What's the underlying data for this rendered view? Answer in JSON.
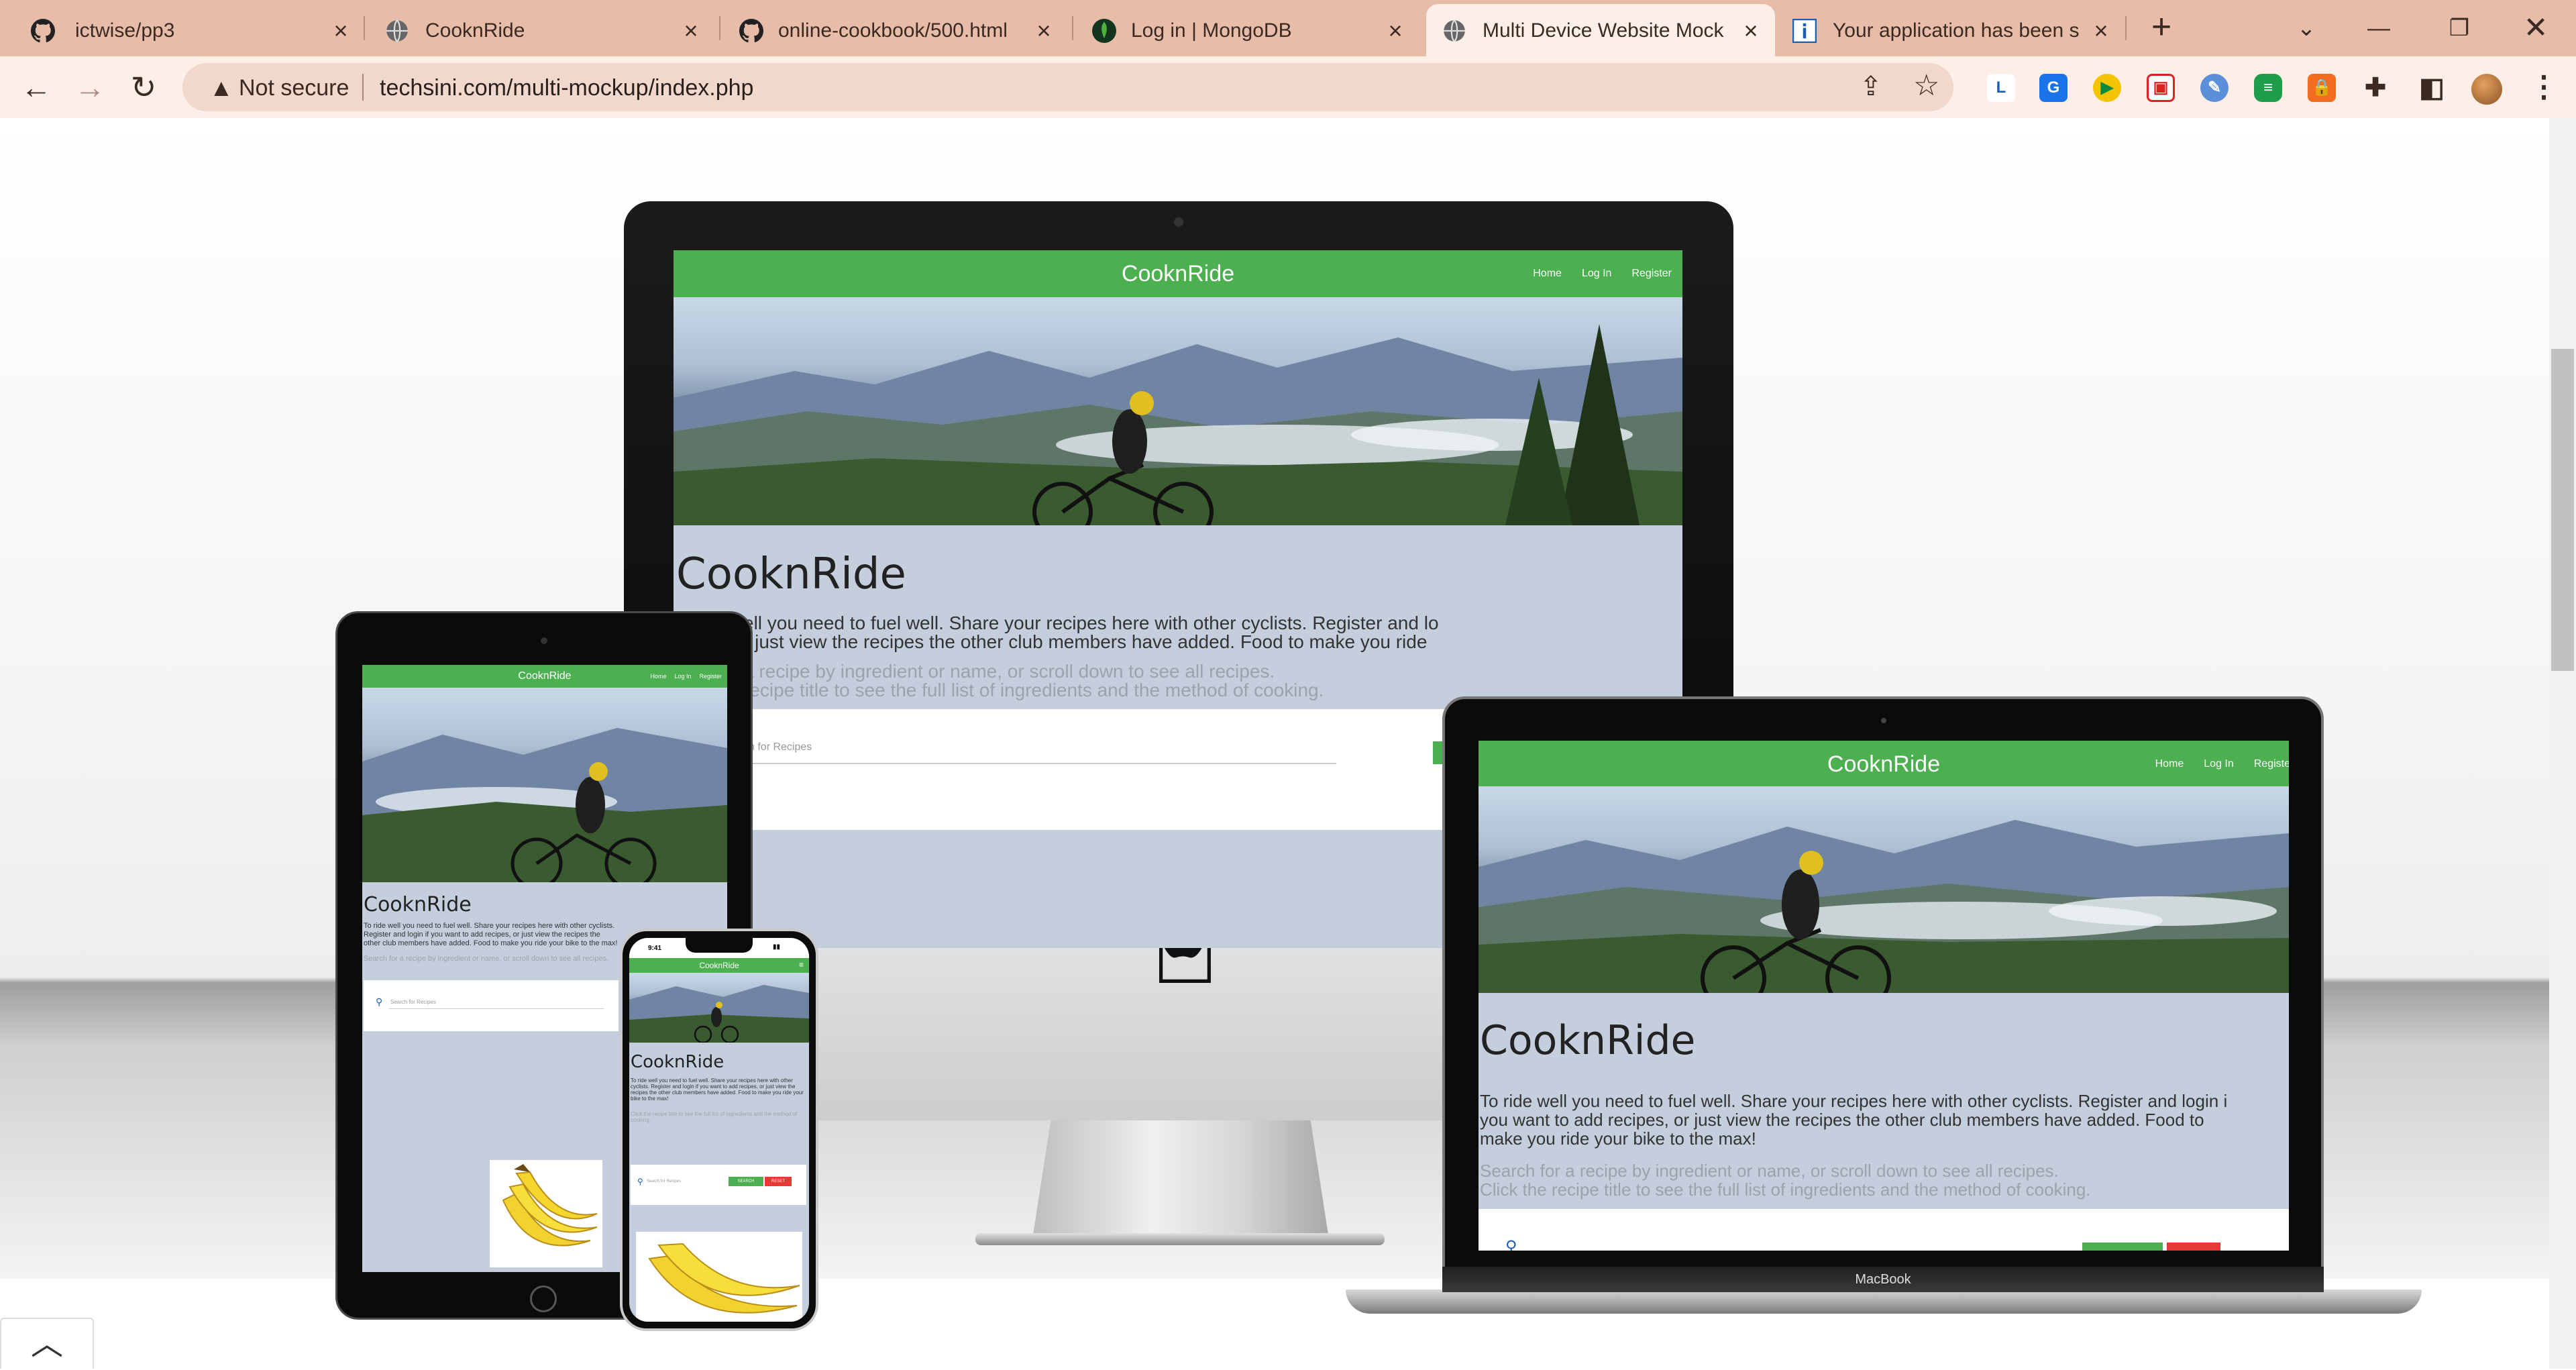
{
  "browser": {
    "tabs": [
      {
        "title": "ictwise/pp3",
        "icon": "github-icon"
      },
      {
        "title": "CooknRide",
        "icon": "globe-icon"
      },
      {
        "title": "online-cookbook/500.html",
        "icon": "github-icon"
      },
      {
        "title": "Log in | MongoDB",
        "icon": "mongodb-leaf-icon"
      },
      {
        "title": "Multi Device Website Mock",
        "icon": "globe-icon",
        "active": true
      },
      {
        "title": "Your application has been s",
        "icon": "info-icon"
      }
    ],
    "new_tab": "+",
    "security_label": "Not secure",
    "url": "techsini.com/multi-mockup/index.php"
  },
  "mock": {
    "site": {
      "brand": "CooknRide",
      "nav": [
        "Home",
        "Log In",
        "Register"
      ],
      "heading": "CooknRide",
      "intro": "To ride well you need to fuel well. Share your recipes here with other cyclists. Register and login if you want to add recipes, or just view the recipes the other club members have added. Food to make you ride your bike to the max!",
      "hint1": "Search for a recipe by ingredient or name, or scroll down to see all recipes.",
      "hint2": "Click the recipe title to see the full list of ingredients and the method of cooking.",
      "search_placeholder": "Search for Recipes",
      "search_button": "SEARCH",
      "reset_button": "RESET"
    },
    "desktop": {
      "visible_heading": "CooknRide",
      "visible_intro": "ell you need to fuel well. Share your recipes here with other cyclists. Register and lo",
      "visible_intro2": "r just view the recipes the other club members have added. Food to make you ride",
      "visible_hint1": "a recipe by ingredient or name, or scroll down to see all recipes.",
      "visible_hint2": "recipe title to see the full list of ingredients and the method of cooking.",
      "visible_search": "ch for Recipes"
    },
    "laptop": {
      "label": "MacBook",
      "visible_intro": "To ride well you need to fuel well. Share your recipes here with other cyclists. Register and login i",
      "visible_intro2": "you want to add recipes, or just view the recipes the other club members have added. Food to",
      "visible_intro3": "make you ride your bike to the max!",
      "visible_hint1": "Search for a recipe by ingredient or name, or scroll down to see all recipes.",
      "visible_hint2": "Click the recipe title to see the full list of ingredients and the method of cooking.",
      "visible_nav_register": "Registe"
    },
    "phone": {
      "status_time": "9:41"
    }
  },
  "colors": {
    "site_green": "#4caf50",
    "site_bg": "#c5cedd",
    "tabbar": "#e7bca9",
    "toolbar": "#fdefe8"
  }
}
